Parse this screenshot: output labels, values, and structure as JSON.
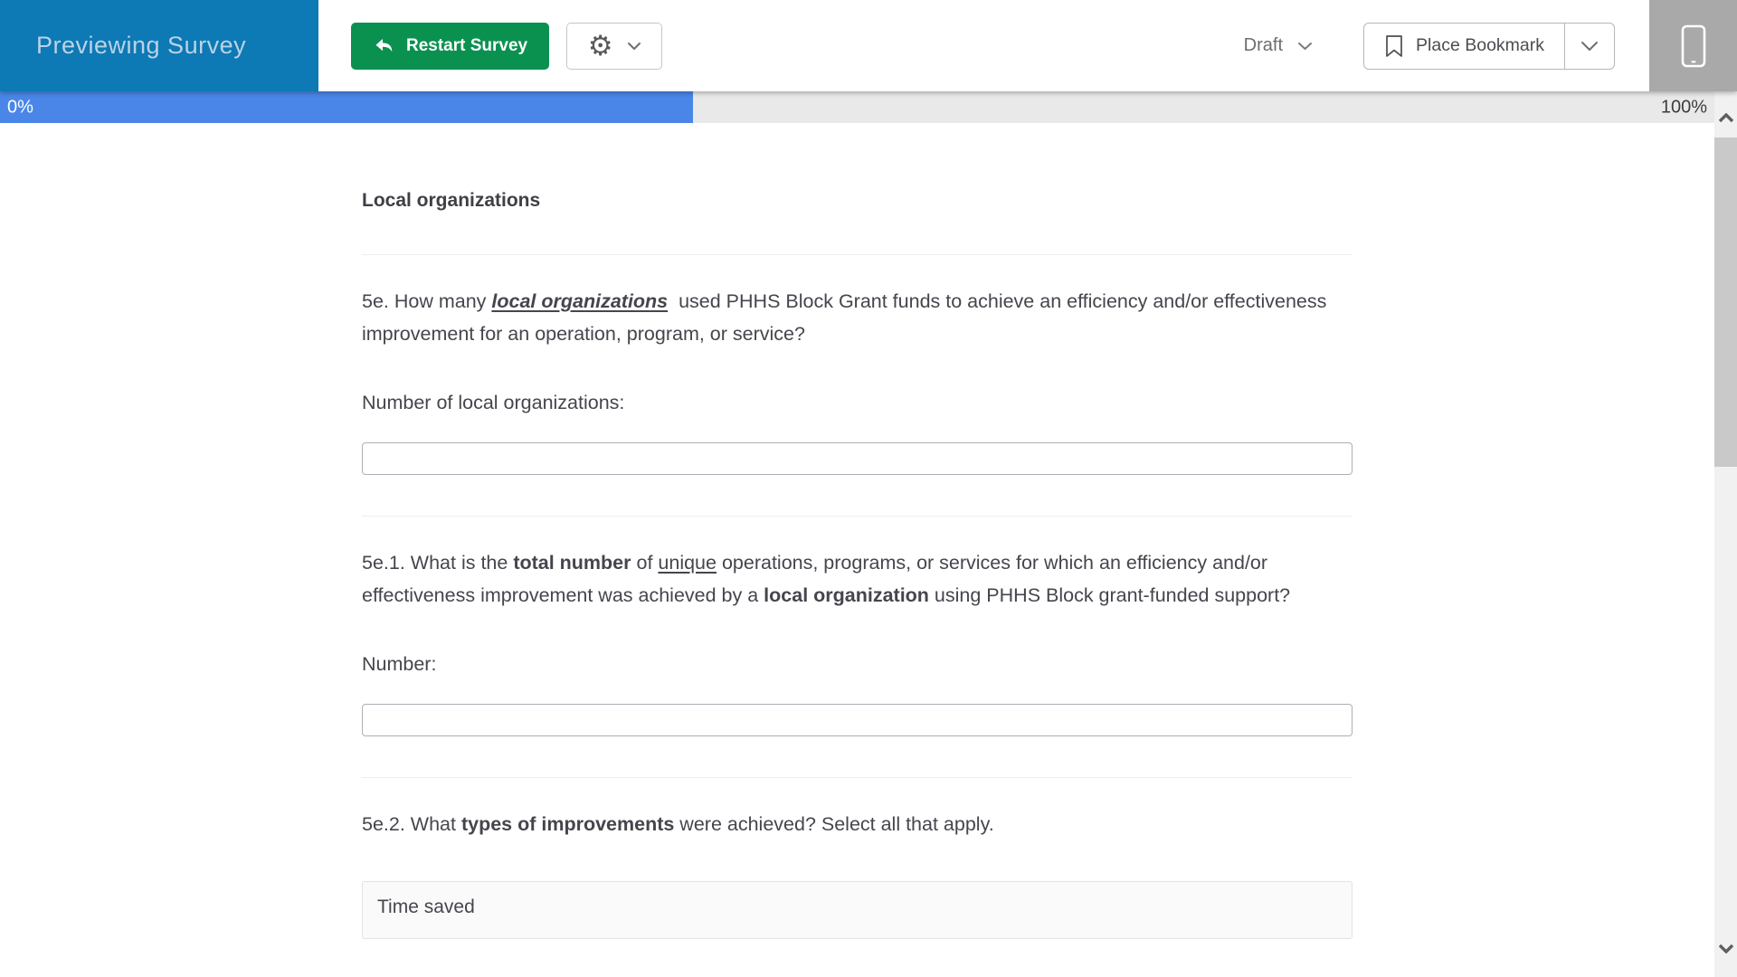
{
  "header": {
    "preview_label": "Previewing Survey",
    "restart_label": "Restart Survey",
    "status_label": "Draft",
    "bookmark_label": "Place Bookmark"
  },
  "progress": {
    "left_label": "0%",
    "right_label": "100%",
    "fill_percent": 40.4
  },
  "survey": {
    "section_title": "Local organizations",
    "questions": [
      {
        "id": "5e",
        "rich_text": [
          {
            "text": "5e. How many ",
            "style": "normal"
          },
          {
            "text": "local organizations",
            "style": "bold-italic-underline"
          },
          {
            "text": "  used PHHS Block Grant funds to achieve an efficiency and/or effectiveness improvement for an operation, program, or service?",
            "style": "normal"
          }
        ],
        "input_label": "Number of local organizations:",
        "input_value": ""
      },
      {
        "id": "5e.1",
        "rich_text": [
          {
            "text": "5e.1. What is the ",
            "style": "normal"
          },
          {
            "text": "total number",
            "style": "bold"
          },
          {
            "text": " of ",
            "style": "normal"
          },
          {
            "text": "unique",
            "style": "underline"
          },
          {
            "text": " operations, programs, or services for which an efficiency and/or effectiveness improvement was achieved by a ",
            "style": "normal"
          },
          {
            "text": "local organization",
            "style": "bold"
          },
          {
            "text": " using PHHS Block grant-funded support?",
            "style": "normal"
          }
        ],
        "input_label": "Number:",
        "input_value": ""
      },
      {
        "id": "5e.2",
        "rich_text": [
          {
            "text": "5e.2. What ",
            "style": "normal"
          },
          {
            "text": "types of improvements",
            "style": "bold"
          },
          {
            "text": " were achieved? Select all that apply.",
            "style": "normal"
          }
        ],
        "options": [
          "Time saved"
        ]
      }
    ]
  },
  "icons": {
    "restart": "curved-undo-arrow",
    "settings": "gear",
    "chevron_down": "chevron-down",
    "bookmark": "bookmark-outline",
    "mobile_device": "phone-outline",
    "scroll_up": "chevron-up",
    "scroll_down": "chevron-down"
  },
  "colors": {
    "header_blue": "#0d79b5",
    "restart_green": "#0a9150",
    "progress_fill": "#4a86e8",
    "progress_track": "#e9e9e9",
    "device_gray": "#a9a9a9",
    "text": "#45454d"
  }
}
